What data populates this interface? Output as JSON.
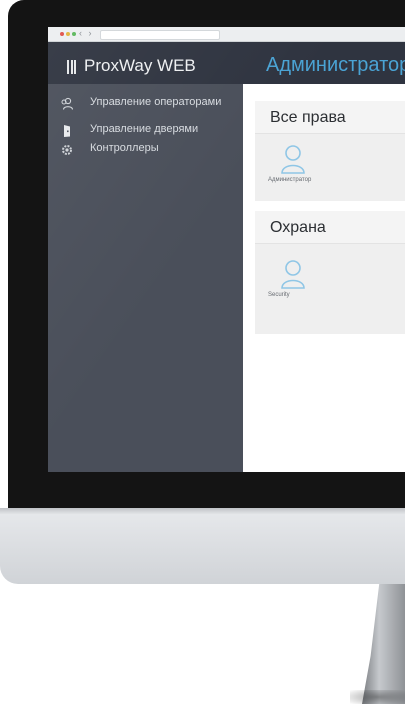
{
  "app": {
    "title": "ProxWay WEB"
  },
  "header": {
    "title": "Администратор"
  },
  "sidebar": {
    "items": [
      {
        "label": "Управление операторами",
        "icon": "users-icon"
      },
      {
        "label": "Управление дверями",
        "icon": "door-icon"
      },
      {
        "label": "Контроллеры",
        "icon": "gear-icon"
      }
    ]
  },
  "groups": [
    {
      "title": "Все права",
      "users": [
        {
          "name": "Администратор",
          "icon": "user-icon"
        }
      ]
    },
    {
      "title": "Охрана",
      "users": [
        {
          "name": "Security",
          "icon": "user-icon"
        }
      ]
    }
  ],
  "colors": {
    "header_bg": "#2f3440",
    "sidebar_bg": "#4a4f5a",
    "accent": "#4aa3d4",
    "card_bg": "#efefef"
  }
}
